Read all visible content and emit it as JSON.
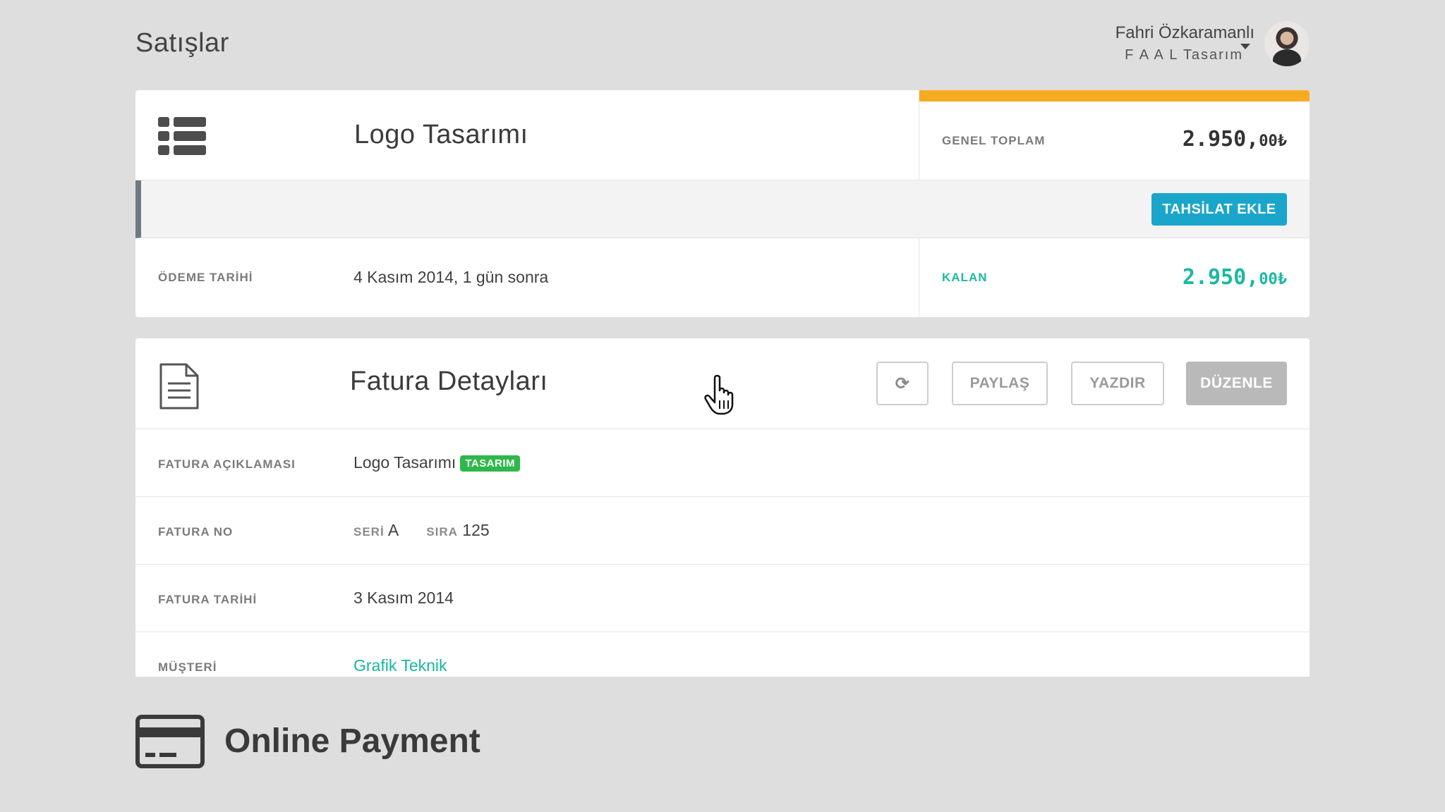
{
  "header": {
    "page_title": "Satışlar",
    "user_name": "Fahri Özkaramanlı",
    "company": "F A A L Tasarım"
  },
  "sale": {
    "title": "Logo Tasarımı",
    "total_label": "GENEL TOPLAM",
    "total_amount_main": "2.950,",
    "total_amount_decimal": "00₺",
    "add_payment_label": "TAHSİLAT EKLE",
    "due_label": "ÖDEME TARİHİ",
    "due_value": "4 Kasım 2014, 1 gün sonra",
    "remaining_label": "KALAN",
    "remaining_amount_main": "2.950,",
    "remaining_amount_decimal": "00₺"
  },
  "invoice": {
    "title": "Fatura Detayları",
    "refresh_symbol": "⟳",
    "share_label": "PAYLAŞ",
    "print_label": "YAZDIR",
    "edit_label": "DÜZENLE",
    "desc_label": "FATURA AÇIKLAMASI",
    "desc_value": "Logo Tasarımı",
    "desc_tag": "TASARIM",
    "no_label": "FATURA NO",
    "seri_label": "SERİ",
    "seri_value": "A",
    "sira_label": "SIRA",
    "sira_value": "125",
    "date_label": "FATURA TARİHİ",
    "date_value": "3 Kasım 2014",
    "customer_label": "MÜŞTERİ",
    "customer_value": "Grafik Teknik"
  },
  "footer": {
    "brand_text": "Online Payment"
  },
  "colors": {
    "accent_orange": "#f6ac21",
    "accent_blue": "#1aa6cb",
    "accent_green": "#1ab99f",
    "tag_green": "#2eb84b",
    "background": "#dfdede"
  }
}
